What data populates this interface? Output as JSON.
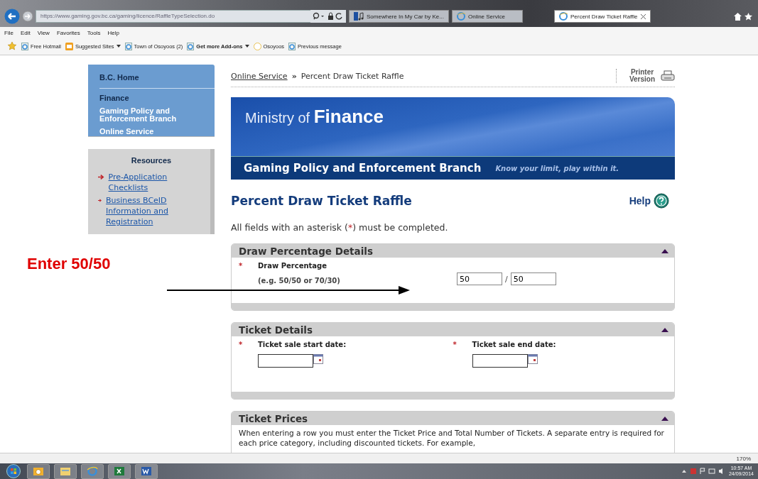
{
  "browser": {
    "address": "https://www.gaming.gov.bc.ca/gaming/licence/RaffleTypeSelection.do",
    "tabs": [
      {
        "label": "Somewhere In My Car by Ke...",
        "kind": "music",
        "selected": false
      },
      {
        "label": "Online Service",
        "kind": "page",
        "selected": false
      },
      {
        "label": "Percent Draw Ticket Raffle",
        "kind": "page",
        "selected": true
      }
    ],
    "menu": [
      "File",
      "Edit",
      "View",
      "Favorites",
      "Tools",
      "Help"
    ],
    "favorites": [
      {
        "label": "Free Hotmail",
        "kind": "page",
        "bold": false,
        "dropdown": false
      },
      {
        "label": "Suggested Sites",
        "kind": "feed",
        "bold": false,
        "dropdown": true
      },
      {
        "label": "Town of Osoyoos (2)",
        "kind": "page",
        "bold": false,
        "dropdown": false
      },
      {
        "label": "Get more Add-ons",
        "kind": "page",
        "bold": true,
        "dropdown": true
      },
      {
        "label": "Osoyoos",
        "kind": "circle",
        "bold": false,
        "dropdown": false
      },
      {
        "label": "Previous message",
        "kind": "page",
        "bold": false,
        "dropdown": false
      }
    ],
    "zoom": "170%"
  },
  "sidebar": {
    "home": "B.C. Home",
    "links": [
      "Finance",
      "Gaming Policy and Enforcement Branch",
      "Online Service"
    ],
    "resources_title": "Resources",
    "resources": [
      "Pre-Application Checklists",
      "Business BCeID Information and Registration"
    ]
  },
  "breadcrumb": {
    "link": "Online Service",
    "separator": "»",
    "current": "Percent Draw Ticket Raffle"
  },
  "printer": "Printer Version",
  "banner": {
    "prefix": "Ministry of",
    "name": "Finance",
    "branch": "Gaming Policy and Enforcement Branch",
    "slogan": "Know your limit, play within it."
  },
  "title": "Percent Draw Ticket Raffle",
  "help": "Help",
  "note": {
    "before": "All fields with an asterisk (",
    "mark": "*",
    "after": ") must be completed."
  },
  "sections": [
    {
      "title": "Draw Percentage Details",
      "expanded": true,
      "kind": "percentage",
      "required": "*",
      "label": "Draw Percentage",
      "hint": "(e.g. 50/50 or 70/30)",
      "first": "50",
      "separator": "/",
      "second": "50"
    },
    {
      "title": "Ticket Details",
      "expanded": true,
      "kind": "dates",
      "fields": [
        {
          "required": "*",
          "label": "Ticket sale start date:"
        },
        {
          "required": "*",
          "label": "Ticket sale end date:"
        }
      ]
    },
    {
      "title": "Ticket Prices",
      "expanded": true,
      "kind": "text",
      "text": "When entering a row you must enter the Ticket Price and Total Number of Tickets. A separate entry is required for each price category, including discounted tickets. For example,"
    }
  ],
  "annotation": {
    "text": "Enter 50/50"
  },
  "taskbar": {
    "apps": [
      {
        "kind": "start"
      },
      {
        "kind": "outlook"
      },
      {
        "kind": "explorer"
      },
      {
        "kind": "ie"
      },
      {
        "kind": "excel"
      },
      {
        "kind": "word"
      }
    ],
    "time": "10:57 AM",
    "date": "24/09/2014"
  }
}
